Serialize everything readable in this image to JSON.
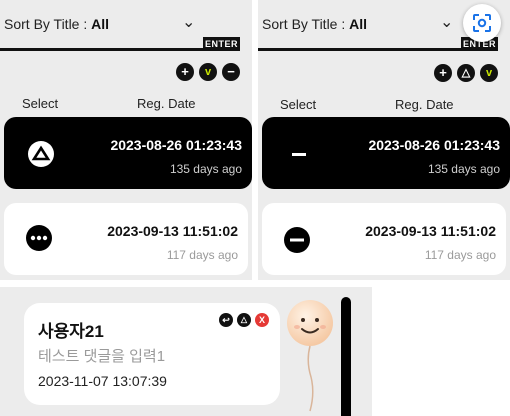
{
  "sort": {
    "prefix": "Sort By Title : ",
    "value": "All",
    "enter_label": "ENTER"
  },
  "columns": {
    "select": "Select",
    "reg_date": "Reg. Date"
  },
  "left_panel": {
    "actions": [
      "+",
      "v",
      "−"
    ],
    "rows": [
      {
        "date": "2023-08-26 01:23:43",
        "ago": "135 days ago",
        "icon": "triangle-icon",
        "selected": true
      },
      {
        "date": "2023-09-13 11:51:02",
        "ago": "117 days ago",
        "icon": "more-dots-icon",
        "selected": false
      }
    ]
  },
  "right_panel": {
    "actions": [
      "+",
      "△",
      "v"
    ],
    "rows": [
      {
        "date": "2023-08-26 01:23:43",
        "ago": "135 days ago",
        "icon": "minus-icon",
        "selected": true
      },
      {
        "date": "2023-09-13 11:51:02",
        "ago": "117 days ago",
        "icon": "minus-circle-icon",
        "selected": false
      }
    ]
  },
  "comment": {
    "author": "사용자21",
    "text": "테스트 댓글을 입력1",
    "timestamp": "2023-11-07 13:07:39",
    "mini_actions": [
      "↩",
      "△",
      "X"
    ]
  },
  "colors": {
    "accent_green": "#c8e600",
    "danger": "#e53935",
    "dark": "#000000"
  }
}
